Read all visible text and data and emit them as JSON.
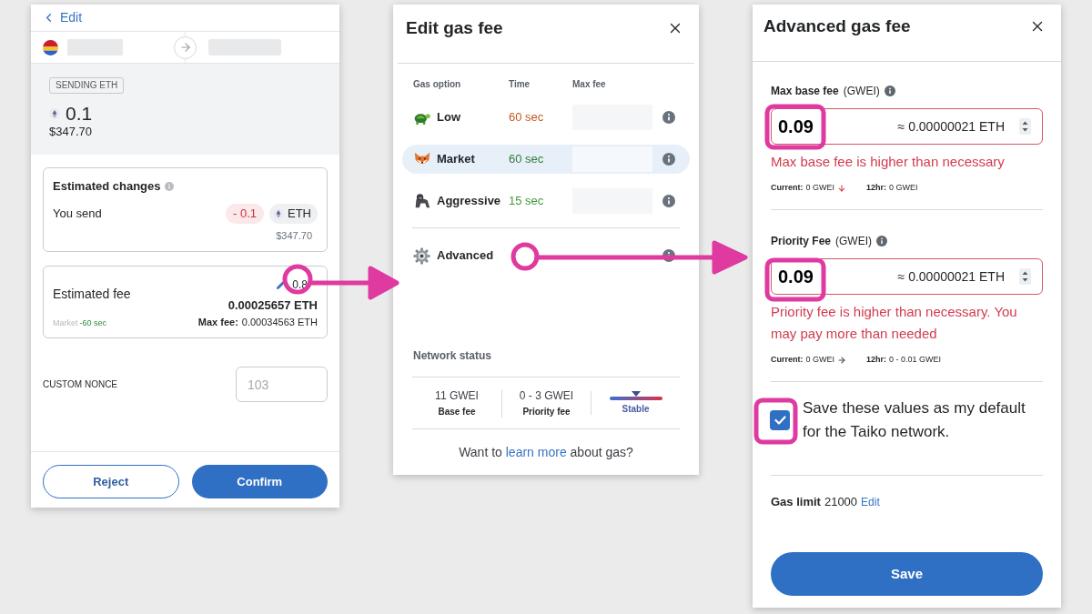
{
  "send_panel": {
    "back_link": "Edit",
    "sending_tag": "SENDING ETH",
    "amount": "0.1",
    "amount_fiat": "$347.70",
    "estimated_changes": {
      "title": "Estimated changes",
      "label": "You send",
      "delta": "- 0.1",
      "token": "ETH",
      "fiat": "$347.70"
    },
    "estimated_fee": {
      "title": "Estimated fee",
      "fiat": "0.8",
      "amount": "0.00025657 ETH",
      "option": "Market",
      "time": "-60 sec",
      "max_fee_label": "Max fee:",
      "max_fee": "0.00034563 ETH"
    },
    "custom_nonce": {
      "label": "CUSTOM NONCE",
      "placeholder": "103"
    },
    "buttons": [
      {
        "label": "Reject",
        "kind": "secondary"
      },
      {
        "label": "Confirm",
        "kind": "primary"
      }
    ]
  },
  "edit_gas_panel": {
    "title": "Edit gas fee",
    "columns": [
      "Gas option",
      "Time",
      "Max fee"
    ],
    "options": [
      {
        "name": "Low",
        "time": "60 sec",
        "color": "#c25a1e",
        "selected": false
      },
      {
        "name": "Market",
        "time": "60 sec",
        "color": "#2f7d3a",
        "selected": true
      },
      {
        "name": "Aggressive",
        "time": "15 sec",
        "color": "#3f9a3c",
        "selected": false
      }
    ],
    "advanced": "Advanced",
    "network_status": {
      "title": "Network status",
      "stats": [
        {
          "value": "11 GWEI",
          "label": "Base fee"
        },
        {
          "value": "0 - 3 GWEI",
          "label": "Priority fee"
        }
      ],
      "trend": "Stable"
    },
    "help": {
      "before": "Want to",
      "link": "learn more",
      "after": "about gas?"
    }
  },
  "advanced_gas_panel": {
    "title": "Advanced gas fee",
    "fields": [
      {
        "kind": "falling",
        "label": "Max base fee",
        "unit": "(GWEI)",
        "value": "0.09",
        "conversion": "≈ 0.00000021 ETH",
        "error": "Max base fee is higher than necessary",
        "current_label": "Current:",
        "current": "0 GWEI",
        "history_label": "12hr:",
        "history": "0 GWEI"
      },
      {
        "kind": "steady",
        "label": "Priority Fee",
        "unit": "(GWEI)",
        "value": "0.09",
        "conversion": "≈ 0.00000021 ETH",
        "error": "Priority fee is higher than necessary. You may pay more than needed",
        "current_label": "Current:",
        "current": "0 GWEI",
        "history_label": "12hr:",
        "history": "0 - 0.01 GWEI"
      }
    ],
    "save_default": {
      "label": "Save these values as my default for the Taiko network.",
      "checked": true
    },
    "gas_limit": {
      "label": "Gas limit",
      "value": "21000",
      "edit": "Edit"
    },
    "save_button": "Save"
  }
}
